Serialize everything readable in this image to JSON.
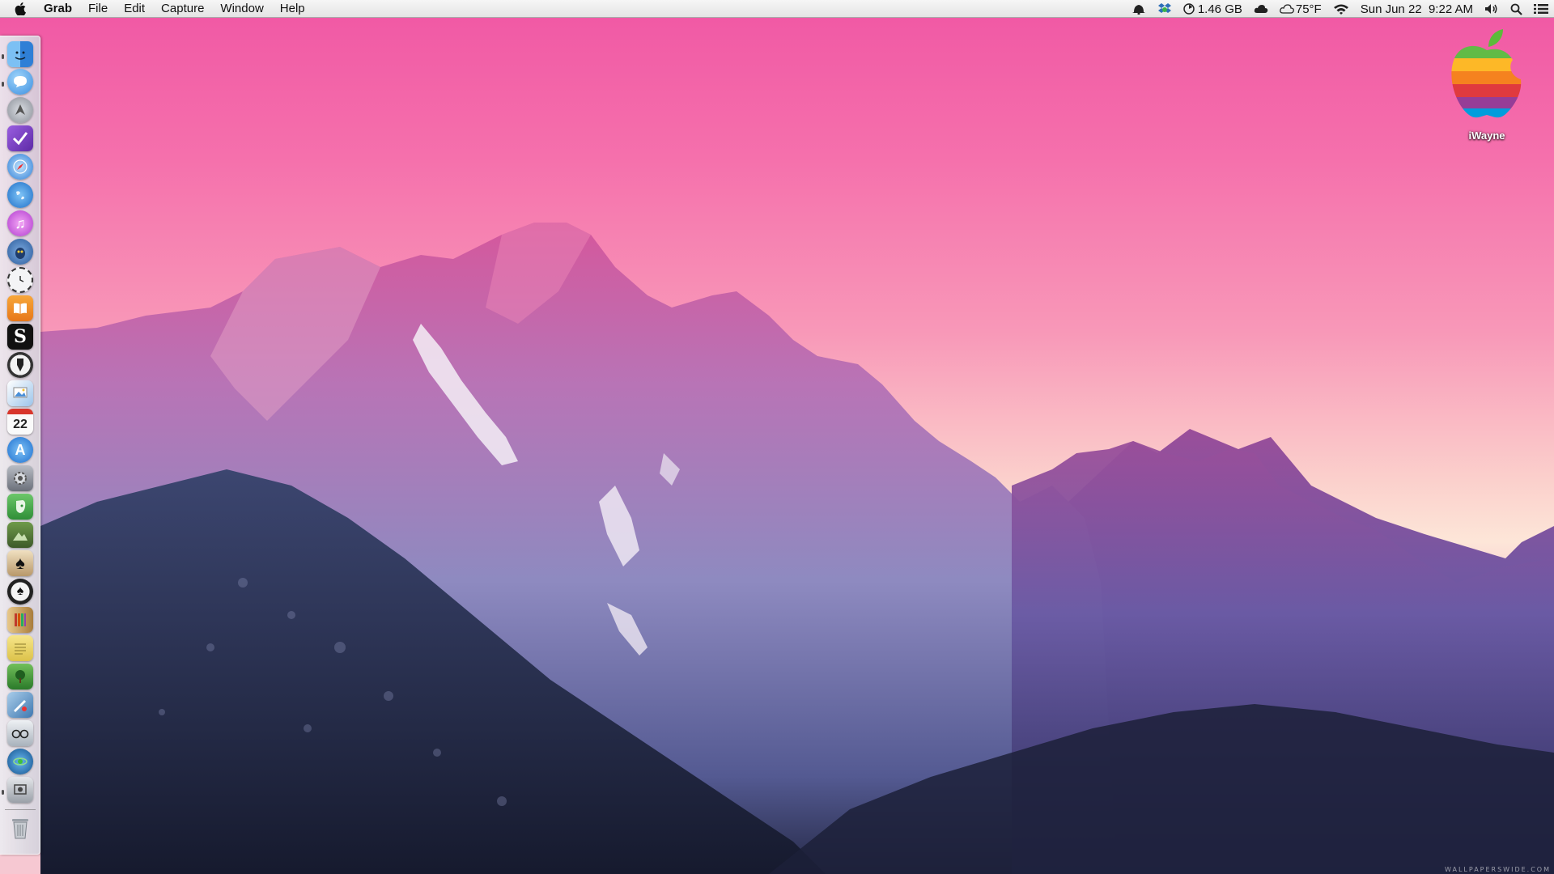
{
  "menubar": {
    "app_name": "Grab",
    "menus": [
      "File",
      "Edit",
      "Capture",
      "Window",
      "Help"
    ],
    "status": {
      "memory": "1.46 GB",
      "weather": "75°F",
      "datetime": "Sun Jun 22  9:22 AM"
    }
  },
  "dock": {
    "calendar_day": "22",
    "items": [
      {
        "icon": "finder-icon",
        "color": "#3a8ee6"
      },
      {
        "icon": "messages-icon",
        "color": "#4aa8f0"
      },
      {
        "icon": "launchpad-icon",
        "color": "#8d939c"
      },
      {
        "icon": "omnifocus-icon",
        "color": "#7b3fc4"
      },
      {
        "icon": "safari-icon",
        "color": "#2f7fd8"
      },
      {
        "icon": "globe-icon",
        "color": "#2d8fe0"
      },
      {
        "icon": "itunes-icon",
        "color": "#c64fd6"
      },
      {
        "icon": "tweetbot-icon",
        "color": "#3a6fb0"
      },
      {
        "icon": "clock-icon",
        "color": "#e8e8ec"
      },
      {
        "icon": "ibooks-icon",
        "color": "#f08a1c"
      },
      {
        "icon": "scrivener-icon",
        "color": "#1a1a1a"
      },
      {
        "icon": "pen-tool-icon",
        "color": "#2a2a2a"
      },
      {
        "icon": "preview-icon",
        "color": "#6aa0d8"
      },
      {
        "icon": "calendar-icon",
        "color": "#f4f4f4"
      },
      {
        "icon": "app-store-icon",
        "color": "#2e82e0"
      },
      {
        "icon": "system-preferences-icon",
        "color": "#7f8590"
      },
      {
        "icon": "evernote-icon",
        "color": "#3fa54a"
      },
      {
        "icon": "photo-app-icon",
        "color": "#5a7a3a"
      },
      {
        "icon": "spades-icon",
        "color": "#d8c09a"
      },
      {
        "icon": "spade-badge-icon",
        "color": "#222222"
      },
      {
        "icon": "bookshelf-icon",
        "color": "#c9a25c"
      },
      {
        "icon": "notes-icon",
        "color": "#e9d267"
      },
      {
        "icon": "pocket-tree-icon",
        "color": "#3e9a3c"
      },
      {
        "icon": "pixelmator-icon",
        "color": "#5b8fbd"
      },
      {
        "icon": "reading-glasses-icon",
        "color": "#bcc4cc"
      },
      {
        "icon": "network-globe-icon",
        "color": "#2270b8"
      },
      {
        "icon": "grab-icon",
        "color": "#a7acb4"
      }
    ],
    "trash_icon": "trash-icon"
  },
  "desktop": {
    "icon_label": "iWayne"
  },
  "watermark": "WALLPAPERSWIDE.COM"
}
